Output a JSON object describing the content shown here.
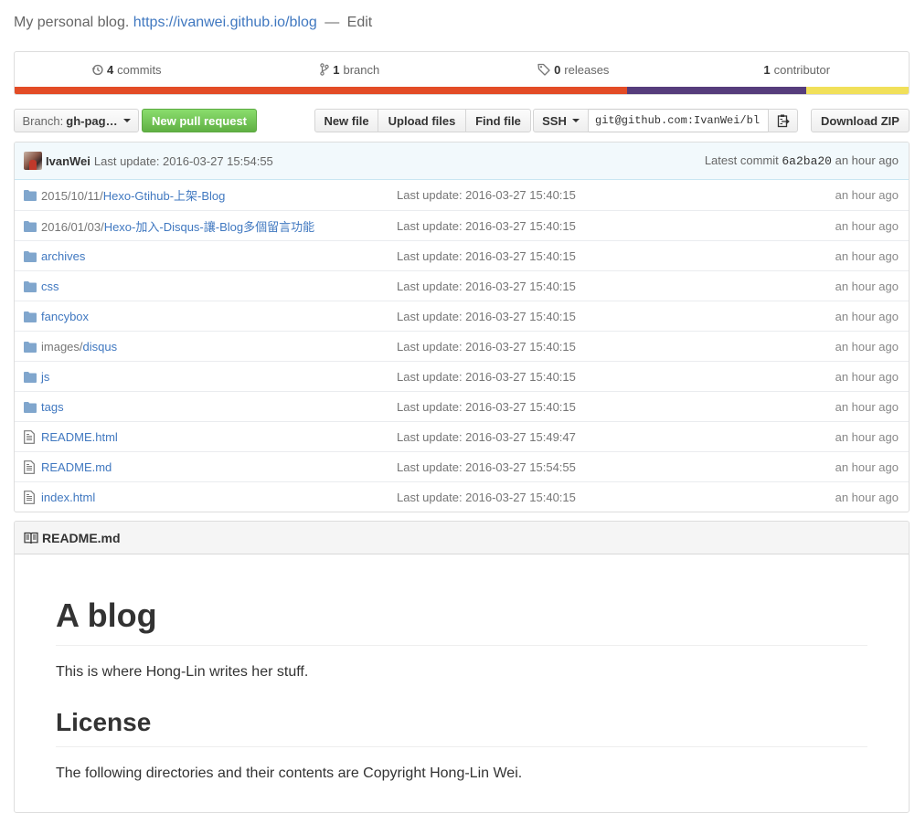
{
  "description": {
    "text": "My personal blog.",
    "url": "https://ivanwei.github.io/blog",
    "separator": "—",
    "edit_label": "Edit"
  },
  "summary": {
    "commits": {
      "count": "4",
      "label": "commits",
      "icon": "history-icon"
    },
    "branches": {
      "count": "1",
      "label": "branch",
      "icon": "git-branch-icon"
    },
    "releases": {
      "count": "0",
      "label": "releases",
      "icon": "tag-icon"
    },
    "contributors": {
      "count": "1",
      "label": "contributor"
    },
    "language_colors": [
      "#e34c26",
      "#563d7c",
      "#f1e05a"
    ],
    "language_fractions": [
      0.685,
      0.2,
      0.115
    ]
  },
  "toolbar": {
    "branch_prefix": "Branch:",
    "branch_name": "gh-pag…",
    "new_pr_label": "New pull request",
    "new_file_label": "New file",
    "upload_files_label": "Upload files",
    "find_file_label": "Find file",
    "clone_protocol": "SSH",
    "clone_url": "git@github.com:IvanWei/bl",
    "copy_icon": "clippy-icon",
    "download_zip_label": "Download ZIP"
  },
  "latest_commit": {
    "author": "IvanWei",
    "message": "Last update: 2016-03-27 15:54:55",
    "label": "Latest commit",
    "sha": "6a2ba20",
    "age": "an hour ago"
  },
  "files": [
    {
      "type": "dir",
      "prefix": "2015/10/11/",
      "name": "Hexo-Gtihub-上架-Blog",
      "message": "Last update: 2016-03-27 15:40:15",
      "age": "an hour ago"
    },
    {
      "type": "dir",
      "prefix": "2016/01/03/",
      "name": "Hexo-加入-Disqus-讓-Blog多個留言功能",
      "message": "Last update: 2016-03-27 15:40:15",
      "age": "an hour ago"
    },
    {
      "type": "dir",
      "prefix": "",
      "name": "archives",
      "message": "Last update: 2016-03-27 15:40:15",
      "age": "an hour ago"
    },
    {
      "type": "dir",
      "prefix": "",
      "name": "css",
      "message": "Last update: 2016-03-27 15:40:15",
      "age": "an hour ago"
    },
    {
      "type": "dir",
      "prefix": "",
      "name": "fancybox",
      "message": "Last update: 2016-03-27 15:40:15",
      "age": "an hour ago"
    },
    {
      "type": "dir",
      "prefix": "images/",
      "name": "disqus",
      "message": "Last update: 2016-03-27 15:40:15",
      "age": "an hour ago"
    },
    {
      "type": "dir",
      "prefix": "",
      "name": "js",
      "message": "Last update: 2016-03-27 15:40:15",
      "age": "an hour ago"
    },
    {
      "type": "dir",
      "prefix": "",
      "name": "tags",
      "message": "Last update: 2016-03-27 15:40:15",
      "age": "an hour ago"
    },
    {
      "type": "file",
      "prefix": "",
      "name": "README.html",
      "message": "Last update: 2016-03-27 15:49:47",
      "age": "an hour ago"
    },
    {
      "type": "file",
      "prefix": "",
      "name": "README.md",
      "message": "Last update: 2016-03-27 15:54:55",
      "age": "an hour ago"
    },
    {
      "type": "file",
      "prefix": "",
      "name": "index.html",
      "message": "Last update: 2016-03-27 15:40:15",
      "age": "an hour ago"
    }
  ],
  "readme": {
    "filename": "README.md",
    "title": "A blog",
    "intro": "This is where Hong-Lin writes her stuff.",
    "license_heading": "License",
    "license_text": "The following directories and their contents are Copyright Hong-Lin Wei."
  }
}
